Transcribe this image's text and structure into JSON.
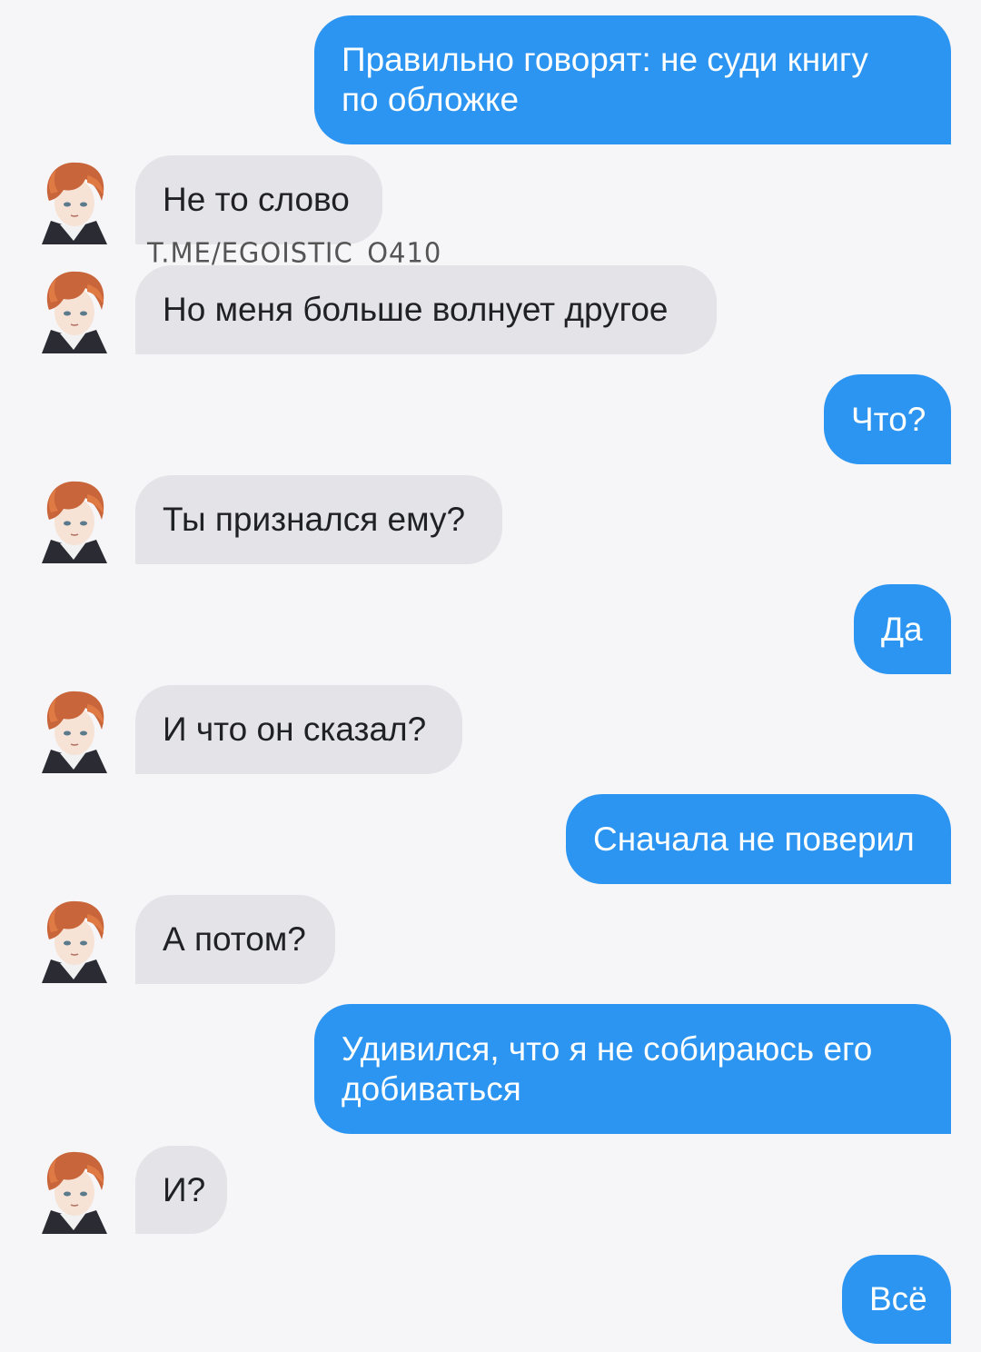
{
  "watermark": "T.ME/EGOISTIC_O410",
  "messages": [
    {
      "side": "out",
      "text": "Правильно говорят: не суди книгу\nпо обложке"
    },
    {
      "side": "in",
      "text": "Не то слово"
    },
    {
      "side": "in",
      "text": "Но меня больше волнует другое"
    },
    {
      "side": "out",
      "text": "Что?"
    },
    {
      "side": "in",
      "text": "Ты признался ему?"
    },
    {
      "side": "out",
      "text": "Да"
    },
    {
      "side": "in",
      "text": "И что он сказал?"
    },
    {
      "side": "out",
      "text": "Сначала не поверил"
    },
    {
      "side": "in",
      "text": "А потом?"
    },
    {
      "side": "out",
      "text": "Удивился, что я не собираюсь его\nдобиваться"
    },
    {
      "side": "in",
      "text": "И?"
    },
    {
      "side": "out",
      "text": "Всё"
    }
  ],
  "colors": {
    "background": "#f6f5f8",
    "outgoing_bubble": "#2c95f2",
    "incoming_bubble": "#e3e3e8"
  },
  "icons": {
    "avatar": "avatar-icon"
  }
}
